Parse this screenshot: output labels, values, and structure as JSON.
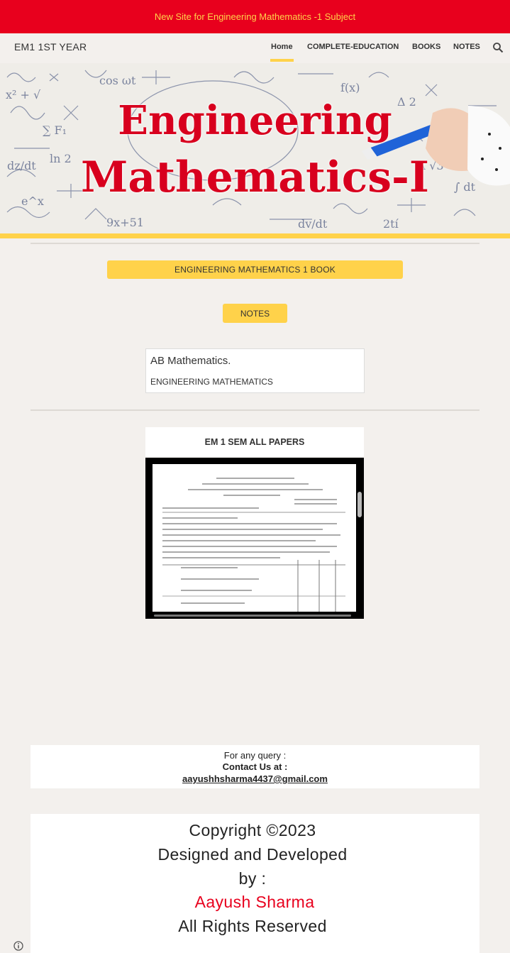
{
  "announcement": {
    "text": "New Site for Engineering Mathematics -1 Subject"
  },
  "header": {
    "site_title": "EM1 1ST YEAR",
    "nav": [
      {
        "label": "Home",
        "active": true
      },
      {
        "label": "COMPLETE-EDUCATION",
        "active": false
      },
      {
        "label": "BOOKS",
        "active": false
      },
      {
        "label": "NOTES",
        "active": false
      }
    ]
  },
  "hero": {
    "line1": "Engineering",
    "line2": "Mathematics-I"
  },
  "buttons": {
    "book": "ENGINEERING MATHEMATICS 1 BOOK",
    "notes": "NOTES"
  },
  "card": {
    "title": "AB Mathematics.",
    "subtitle": "ENGINEERING MATHEMATICS"
  },
  "embed": {
    "title": "EM 1 SEM ALL PAPERS"
  },
  "contact": {
    "query": "For any query :",
    "contact_label": "Contact Us at :",
    "email": "aayushhsharma4437@gmail.com"
  },
  "footer": {
    "copyright": "Copyright  ©2023",
    "designed": "Designed and Developed",
    "by": "by :",
    "name": "Aayush Sharma",
    "rights": "All Rights Reserved"
  },
  "colors": {
    "brand_red": "#e8001d",
    "accent_yellow": "#ffd24a",
    "background": "#f3f0ed"
  }
}
